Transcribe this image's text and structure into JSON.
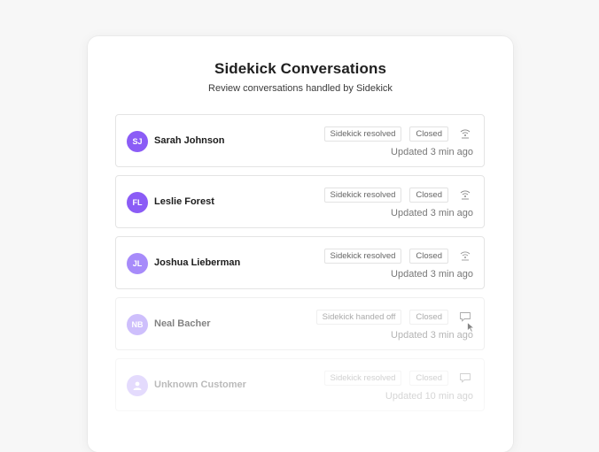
{
  "header": {
    "title": "Sidekick Conversations",
    "subtitle": "Review conversations handled by Sidekick"
  },
  "conversations": [
    {
      "initials": "SJ",
      "name": "Sarah Johnson",
      "status": "Sidekick resolved",
      "state": "Closed",
      "icon": "broadcast-icon",
      "updated": "Updated 3 min ago",
      "avatar_color": "#8b5cf6"
    },
    {
      "initials": "FL",
      "name": "Leslie Forest",
      "status": "Sidekick resolved",
      "state": "Closed",
      "icon": "broadcast-icon",
      "updated": "Updated 3 min ago",
      "avatar_color": "#8b5cf6"
    },
    {
      "initials": "JL",
      "name": "Joshua Lieberman",
      "status": "Sidekick resolved",
      "state": "Closed",
      "icon": "broadcast-icon",
      "updated": "Updated 3 min ago",
      "avatar_color": "#a78bfa"
    },
    {
      "initials": "NB",
      "name": "Neal Bacher",
      "status": "Sidekick handed off",
      "state": "Closed",
      "icon": "chat-icon",
      "updated": "Updated 3 min ago",
      "avatar_color": "#c4b5fd"
    },
    {
      "initials": "",
      "name": "Unknown Customer",
      "status": "Sidekick resolved",
      "state": "Closed",
      "icon": "chat-icon",
      "updated": "Updated 10 min ago",
      "avatar_color": "#ddd6fe"
    }
  ]
}
